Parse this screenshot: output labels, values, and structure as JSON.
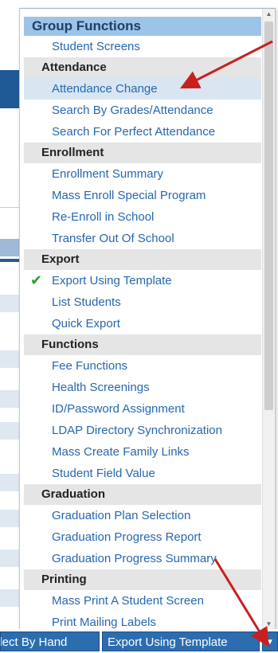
{
  "menu": {
    "title": "Group Functions",
    "top_item": "Student Screens",
    "sections": [
      {
        "header": "Attendance",
        "items": [
          "Attendance Change",
          "Search By Grades/Attendance",
          "Search For Perfect Attendance"
        ]
      },
      {
        "header": "Enrollment",
        "items": [
          "Enrollment Summary",
          "Mass Enroll Special Program",
          "Re-Enroll in School",
          "Transfer Out Of School"
        ]
      },
      {
        "header": "Export",
        "items": [
          "Export Using Template",
          "List Students",
          "Quick Export"
        ]
      },
      {
        "header": "Functions",
        "items": [
          "Fee Functions",
          "Health Screenings",
          "ID/Password Assignment",
          "LDAP Directory Synchronization",
          "Mass Create Family Links",
          "Student Field Value"
        ]
      },
      {
        "header": "Graduation",
        "items": [
          "Graduation Plan Selection",
          "Graduation Progress Report",
          "Graduation Progress Summary"
        ]
      },
      {
        "header": "Printing",
        "items": [
          "Mass Print A Student Screen",
          "Print Mailing Labels"
        ]
      }
    ]
  },
  "buttons": {
    "select_by_hand": "Select By Hand",
    "export_using_template": "Export Using Template"
  },
  "colors": {
    "accent": "#2c6db0",
    "menu_title_bg": "#9cc4e8",
    "link": "#2667b0",
    "annotation_arrow": "#c8201f",
    "check": "#2aa02a"
  },
  "icons": {
    "checked_item": "check-icon",
    "dropdown": "caret-down-icon"
  }
}
